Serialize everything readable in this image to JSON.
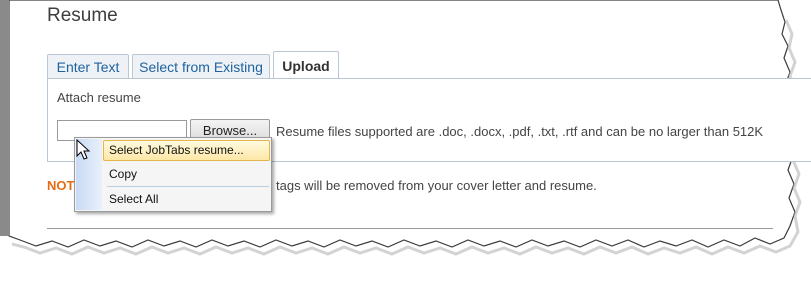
{
  "section": {
    "title": "Resume"
  },
  "tabs": [
    {
      "label": "Enter Text"
    },
    {
      "label": "Select from Existing"
    },
    {
      "label": "Upload",
      "active": true
    }
  ],
  "upload": {
    "attach_label": "Attach resume",
    "browse_label": "Browse...",
    "hint": "Resume files supported are .doc, .docx, .pdf, .txt, .rtf and can be no larger than 512K"
  },
  "note": {
    "label": "NOT",
    "text": "tags will be removed from your cover letter and resume."
  },
  "context_menu": {
    "items": [
      {
        "label": "Select JobTabs resume..."
      },
      {
        "label": "Copy"
      },
      {
        "label": "Select All"
      }
    ]
  },
  "colors": {
    "accent_link": "#1f62a0",
    "note_orange": "#e86b13",
    "menu_highlight": "#fde8a6"
  }
}
